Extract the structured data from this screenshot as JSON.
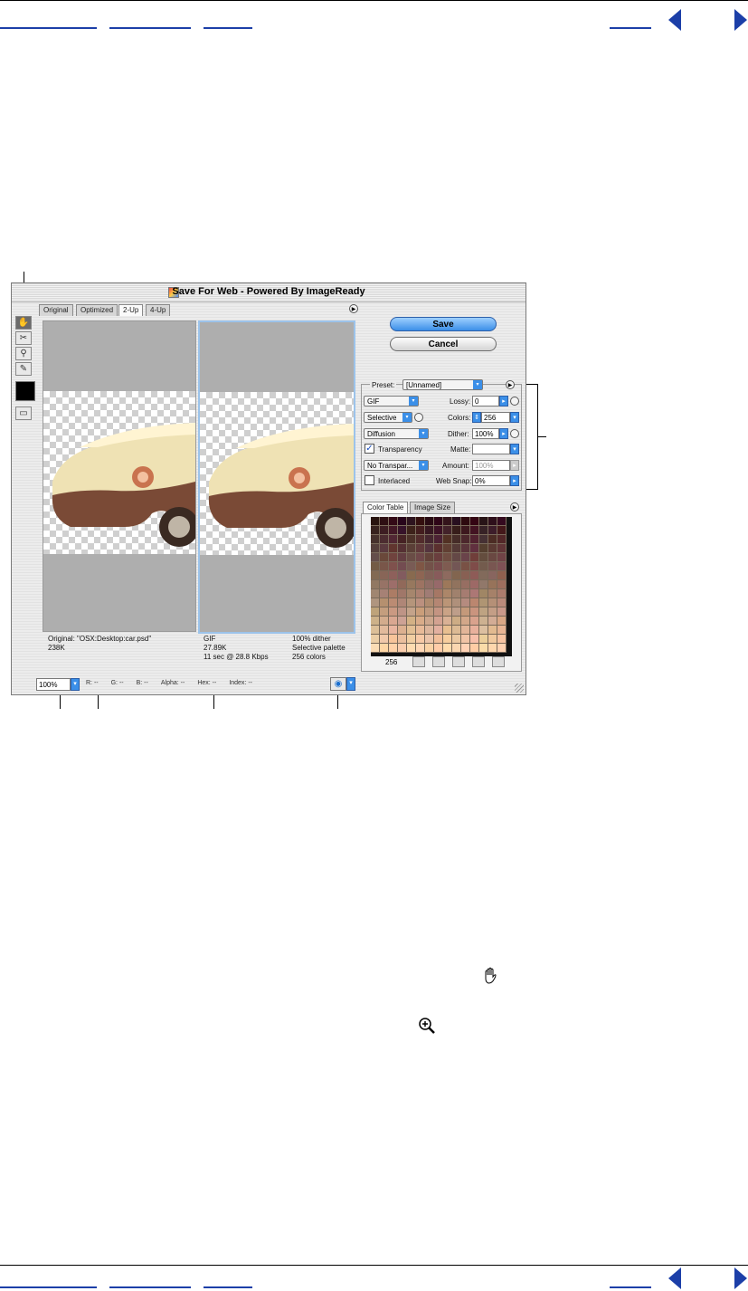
{
  "window": {
    "title": "Save For Web - Powered By ImageReady",
    "tabs": [
      "Original",
      "Optimized",
      "2-Up",
      "4-Up"
    ],
    "active_tab": "2-Up"
  },
  "buttons": {
    "save": "Save",
    "cancel": "Cancel"
  },
  "original_info": {
    "line1": "Original: \"OSX:Desktop:car.psd\"",
    "line2": "238K"
  },
  "optimized_info": {
    "left": [
      "GIF",
      "27.89K",
      "11 sec @ 28.8 Kbps"
    ],
    "right": [
      "100% dither",
      "Selective palette",
      "256 colors"
    ]
  },
  "settings": {
    "preset_label": "Preset:",
    "preset_value": "[Unnamed]",
    "format": "GIF",
    "lossy_label": "Lossy:",
    "lossy_value": "0",
    "reduction": "Selective",
    "colors_label": "Colors:",
    "colors_value": "256",
    "dither_algo": "Diffusion",
    "dither_label": "Dither:",
    "dither_value": "100%",
    "transparency_label": "Transparency",
    "transparency_checked": true,
    "matte_label": "Matte:",
    "matte_value": "",
    "transparency_dither": "No Transpar...",
    "amount_label": "Amount:",
    "amount_value": "100%",
    "interlaced_label": "Interlaced",
    "interlaced_checked": false,
    "websnap_label": "Web Snap:",
    "websnap_value": "0%"
  },
  "color_panel": {
    "tabs": [
      "Color Table",
      "Image Size"
    ],
    "active_tab": "Color Table",
    "color_count": "256"
  },
  "status_bar": {
    "zoom": "100%",
    "readouts": [
      {
        "label": "R:",
        "value": "--"
      },
      {
        "label": "G:",
        "value": "--"
      },
      {
        "label": "B:",
        "value": "--"
      },
      {
        "label": "Alpha:",
        "value": "--"
      },
      {
        "label": "Hex:",
        "value": "--"
      },
      {
        "label": "Index:",
        "value": "--"
      }
    ]
  },
  "colors": {
    "nav_blue": "#1c3fa8",
    "save_button": "#3b8fe8"
  },
  "icons": [
    "hand-icon",
    "slice-select-icon",
    "zoom-icon",
    "eyedropper-icon",
    "color-swatch",
    "preview-toggle-icon",
    "menu-arrow-icon",
    "browser-preview-icon",
    "hand-tool-inline-icon",
    "zoom-tool-inline-icon"
  ]
}
